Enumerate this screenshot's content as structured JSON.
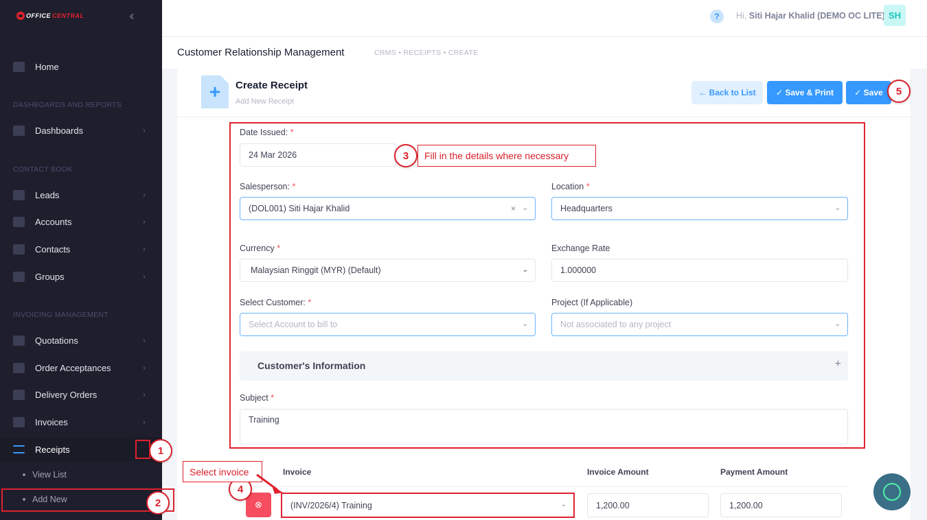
{
  "brand": {
    "part1": "OFFICE",
    "part2": "CENTRAL"
  },
  "sidebar": {
    "home": "Home",
    "sections": [
      "DASHBOARDS AND REPORTS",
      "CONTACT BOOK",
      "INVOICING MANAGEMENT"
    ],
    "dashboards": "Dashboards",
    "leads": "Leads",
    "accounts": "Accounts",
    "contacts": "Contacts",
    "groups": "Groups",
    "quotations": "Quotations",
    "order_acceptances": "Order Acceptances",
    "delivery_orders": "Delivery Orders",
    "invoices": "Invoices",
    "receipts": "Receipts",
    "view_list": "View List",
    "add_new": "Add New"
  },
  "header": {
    "help": "?",
    "greeting_prefix": "Hi,",
    "user": "Siti Hajar Khalid (DEMO OC LITE)",
    "avatar": "SH"
  },
  "subheader": {
    "title": "Customer Relationship Management",
    "breadcrumb": "CRMS  •  RECEIPTS  •  CREATE"
  },
  "card": {
    "title": "Create Receipt",
    "subtitle": "Add New Receipt",
    "back_label": "← Back to List",
    "save_print_label": "✓ Save & Print",
    "save_label": "✓ Save"
  },
  "form": {
    "date_label": "Date Issued:",
    "date_value": "24 Mar 2026",
    "salesperson_label": "Salesperson:",
    "salesperson_value": "(DOL001) Siti Hajar Khalid",
    "location_label": "Location",
    "location_value": "Headquarters",
    "currency_label": "Currency",
    "currency_value": "Malaysian Ringgit (MYR) (Default)",
    "exchange_label": "Exchange Rate",
    "exchange_value": "1.000000",
    "customer_label": "Select Customer:",
    "customer_placeholder": "Select Account to bill to",
    "project_label": "Project (If Applicable)",
    "project_placeholder": "Not associated to any project",
    "customer_info": "Customer's Information",
    "subject_label": "Subject",
    "subject_value": "Training",
    "req": "*"
  },
  "table": {
    "headers": [
      "Invoice",
      "Invoice Amount",
      "Payment Amount"
    ],
    "row": {
      "invoice": "(INV/2026/4) Training",
      "invoice_amount": "1,200.00",
      "payment_amount": "1,200.00"
    }
  },
  "annotations": {
    "step1": "1",
    "step2": "2",
    "step3": "3",
    "step4": "4",
    "step5": "5",
    "callout3": "Fill in the details where necessary",
    "callout4": "Select invoice"
  },
  "colors": {
    "primary": "#3699ff",
    "annotation_red": "#e0222e",
    "sidebar_bg": "#1e1e2d"
  }
}
